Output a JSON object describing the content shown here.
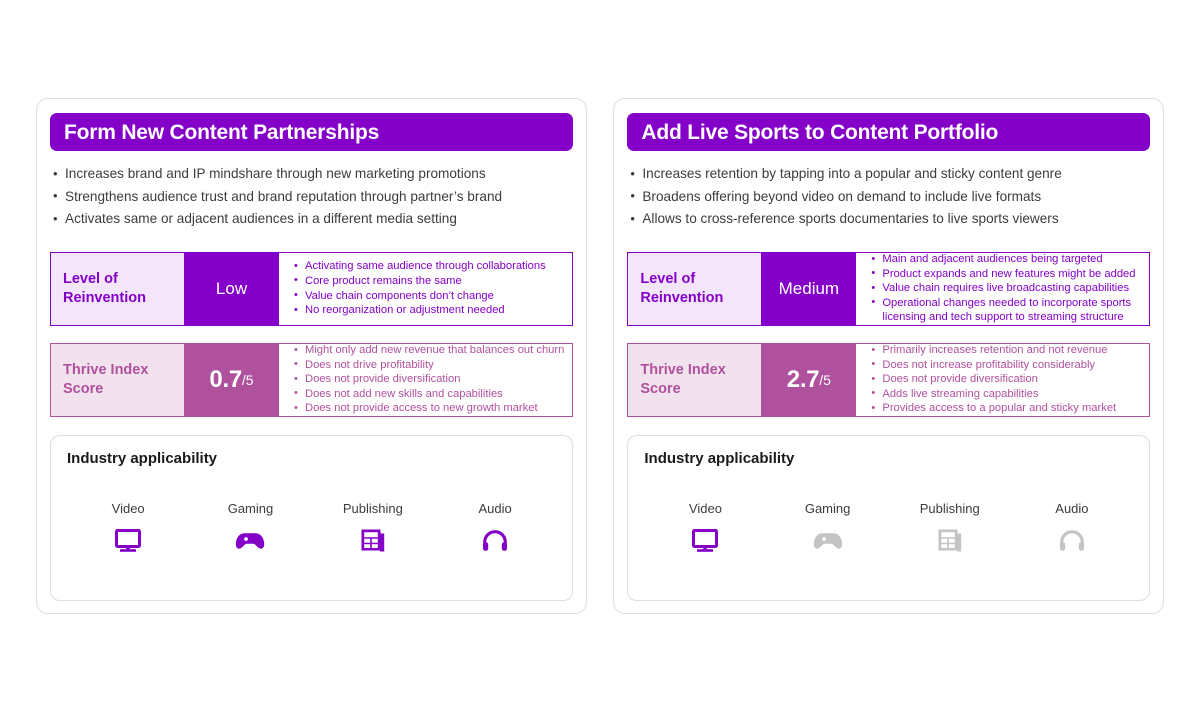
{
  "colors": {
    "purple": "#8400C8",
    "mauve": "#B0519E",
    "purple_tint": "#F3E5FA",
    "mauve_tint": "#F2E2EE",
    "icon_active": "#8400C8",
    "icon_inactive": "#C4C4C4",
    "card_border": "#DDDDE2",
    "body_text": "#3C3C3C"
  },
  "labels": {
    "level_of_reinvention": "Level of\nReinvention",
    "level_of_reinvention_line1": "Level of",
    "level_of_reinvention_line2": "Reinvention",
    "thrive_index_line1": "Thrive Index",
    "thrive_index_line2": "Score",
    "industry_applicability": "Industry applicability",
    "score_denominator": "/5"
  },
  "cards": [
    {
      "title": "Form New Content Partnerships",
      "benefits": [
        "Increases brand and IP mindshare through new marketing promotions",
        "Strengthens audience trust and brand reputation through partner’s brand",
        "Activates same or adjacent audiences in a different media setting"
      ],
      "reinvention": {
        "label_line1": "Level of",
        "label_line2": "Reinvention",
        "value": "Low",
        "details": [
          "Activating same audience through collaborations",
          "Core product remains the same",
          "Value chain components don’t change",
          "No reorganization or adjustment needed"
        ]
      },
      "thrive": {
        "label_line1": "Thrive Index",
        "label_line2": "Score",
        "score": "0.7",
        "denominator": "/5",
        "details": [
          "Might only add new revenue that balances out churn",
          "Does not drive profitability",
          "Does not provide diversification",
          "Does not add new skills and capabilities",
          "Does not provide access to new growth market"
        ]
      },
      "industry": {
        "title": "Industry applicability",
        "items": [
          {
            "name": "Video",
            "icon": "monitor-icon",
            "active": true
          },
          {
            "name": "Gaming",
            "icon": "gamepad-icon",
            "active": true
          },
          {
            "name": "Publishing",
            "icon": "newspaper-icon",
            "active": true
          },
          {
            "name": "Audio",
            "icon": "headphones-icon",
            "active": true
          }
        ]
      }
    },
    {
      "title": "Add Live Sports to Content Portfolio",
      "benefits": [
        "Increases retention by tapping into a popular and sticky content genre",
        "Broadens offering beyond video on demand to include live formats",
        "Allows to cross-reference sports documentaries to live sports viewers"
      ],
      "reinvention": {
        "label_line1": "Level of",
        "label_line2": "Reinvention",
        "value": "Medium",
        "details": [
          "Main and adjacent audiences being targeted",
          "Product expands and new features might be added",
          "Value chain requires live broadcasting capabilities",
          "Operational changes needed to incorporate sports licensing and tech support to streaming structure"
        ]
      },
      "thrive": {
        "label_line1": "Thrive Index",
        "label_line2": "Score",
        "score": "2.7",
        "denominator": "/5",
        "details": [
          "Primarily increases retention and not revenue",
          "Does not increase profitability considerably",
          "Does not provide diversification",
          "Adds live streaming capabilities",
          "Provides access to a popular and sticky market"
        ]
      },
      "industry": {
        "title": "Industry applicability",
        "items": [
          {
            "name": "Video",
            "icon": "monitor-icon",
            "active": true
          },
          {
            "name": "Gaming",
            "icon": "gamepad-icon",
            "active": false
          },
          {
            "name": "Publishing",
            "icon": "newspaper-icon",
            "active": false
          },
          {
            "name": "Audio",
            "icon": "headphones-icon",
            "active": false
          }
        ]
      }
    }
  ]
}
